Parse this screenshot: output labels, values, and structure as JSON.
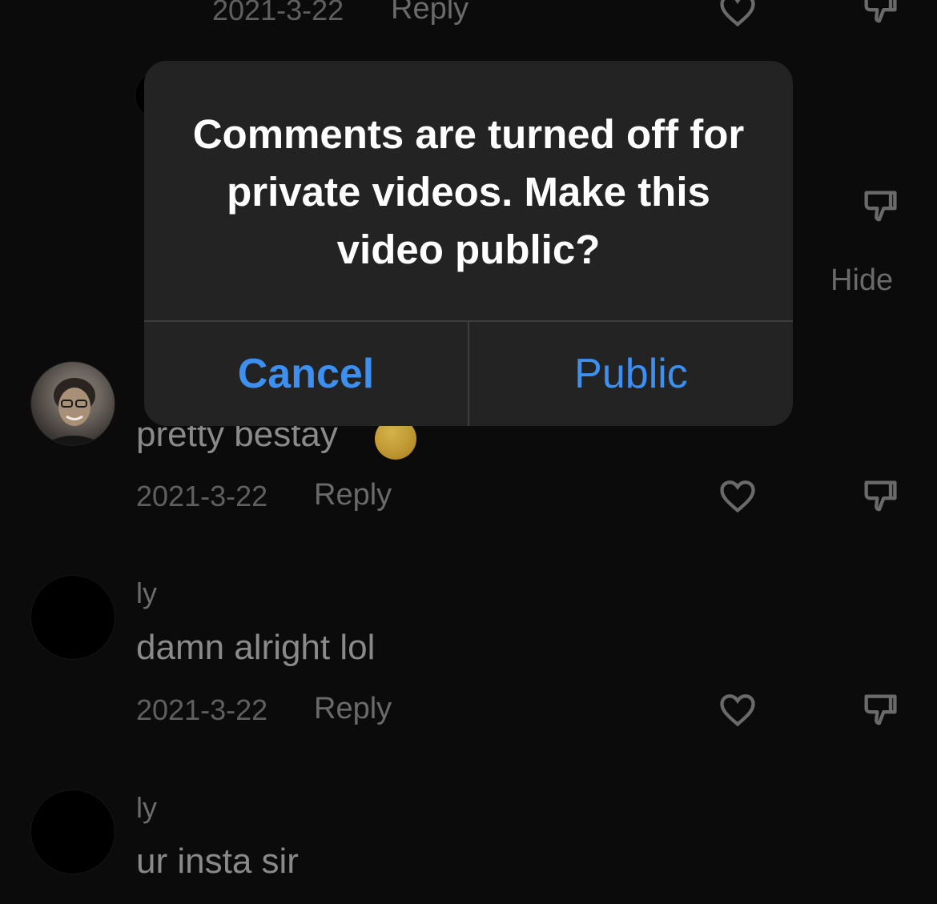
{
  "alert": {
    "message": "Comments are turned off for private videos. Make this video public?",
    "cancel_label": "Cancel",
    "confirm_label": "Public"
  },
  "comments": [
    {
      "date": "2021-3-22",
      "reply_label": "Reply"
    },
    {
      "hide_label": "Hide"
    },
    {
      "text": "pretty bestay",
      "date": "2021-3-22",
      "reply_label": "Reply"
    },
    {
      "username": "ly",
      "text": "damn alright lol",
      "date": "2021-3-22",
      "reply_label": "Reply"
    },
    {
      "username": "ly",
      "text": "ur insta sir"
    }
  ],
  "icons": {
    "like": "heart-icon",
    "dislike": "thumbs-down-icon"
  },
  "colors": {
    "background": "#0b0b0b",
    "alert_background": "#232323",
    "alert_button": "#3d8ff0",
    "alert_text": "#ffffff"
  }
}
